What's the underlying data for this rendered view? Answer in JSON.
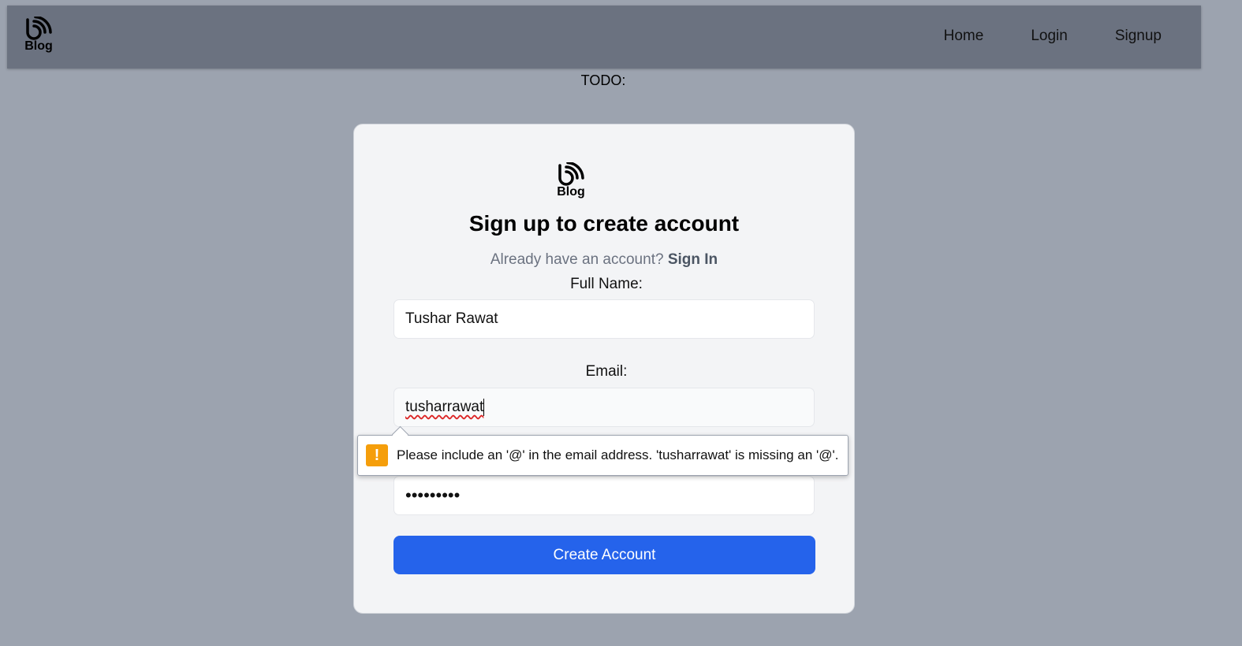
{
  "nav": {
    "logo_text": "Blog",
    "links": [
      "Home",
      "Login",
      "Signup"
    ]
  },
  "todo_text": "TODO:",
  "card": {
    "logo_text": "Blog",
    "title": "Sign up to create account",
    "subtitle_prefix": "Already have an account?",
    "signin_link": "Sign In",
    "full_name_label": "Full Name:",
    "full_name_value": "Tushar Rawat",
    "email_label": "Email:",
    "email_value": "tusharrawat",
    "password_value": "•••••••••",
    "submit_label": "Create Account"
  },
  "validation": {
    "icon": "warning-icon",
    "icon_glyph": "!",
    "message": "Please include an '@' in the email address. 'tusharrawat' is missing an '@'."
  },
  "colors": {
    "page_bg": "#9ca3af",
    "navbar_bg": "#6b7280",
    "card_bg": "#f3f4f6",
    "button_bg": "#2563eb",
    "warning": "#f59e0b"
  }
}
